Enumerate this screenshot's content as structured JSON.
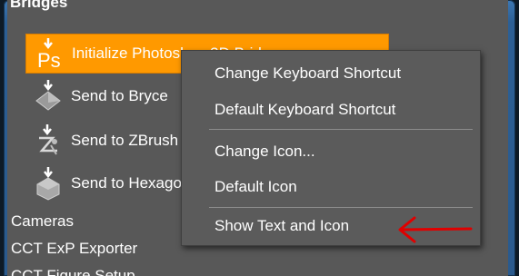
{
  "panel": {
    "section_header": "Bridges",
    "items": [
      {
        "label": "Initialize Photoshop 3D Bridge",
        "icon": "photoshop-icon"
      },
      {
        "label": "Send to Bryce",
        "icon": "bryce-icon"
      },
      {
        "label": "Send to ZBrush",
        "icon": "zbrush-icon"
      },
      {
        "label": "Send to Hexagon",
        "icon": "hexagon-icon"
      }
    ],
    "categories": [
      "Cameras",
      "CCT ExP Exporter",
      "CCT Figure Setup"
    ]
  },
  "context_menu": {
    "items": [
      "Change Keyboard Shortcut",
      "Default Keyboard Shortcut",
      "Change Icon...",
      "Default Icon",
      "Show Text and Icon"
    ]
  },
  "colors": {
    "selection": "#ff9900",
    "panel_bg": "#585858",
    "menu_bg": "#5b5b5b",
    "annotation_arrow": "#e00000"
  }
}
